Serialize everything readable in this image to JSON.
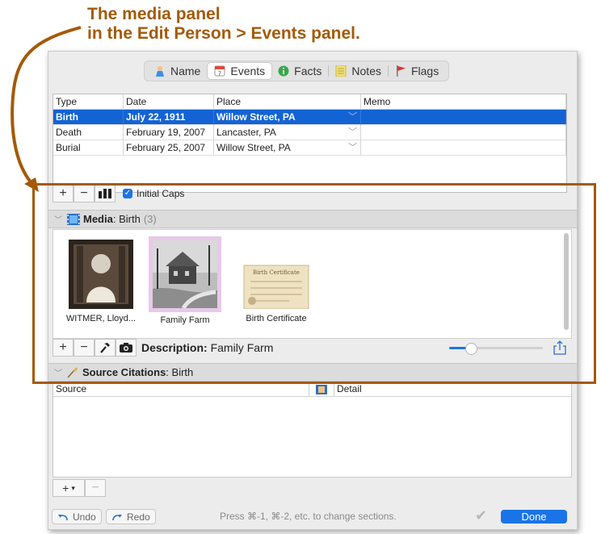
{
  "annotation": {
    "line1": "The media panel",
    "line2": "in the Edit Person > Events panel."
  },
  "tabs": [
    {
      "label": "Name",
      "icon": "person-icon"
    },
    {
      "label": "Events",
      "icon": "calendar-icon",
      "selected": true,
      "badge": "7"
    },
    {
      "label": "Facts",
      "icon": "info-icon"
    },
    {
      "label": "Notes",
      "icon": "notes-icon"
    },
    {
      "label": "Flags",
      "icon": "flag-icon"
    }
  ],
  "events": {
    "columns": [
      "Type",
      "Date",
      "Place",
      "Memo"
    ],
    "rows": [
      {
        "type": "Birth",
        "date": "July 22, 1911",
        "place": "Willow Street, PA",
        "memo": ""
      },
      {
        "type": "Death",
        "date": "February 19, 2007",
        "place": "Lancaster, PA",
        "memo": ""
      },
      {
        "type": "Burial",
        "date": "February 25, 2007",
        "place": "Willow Street, PA",
        "memo": ""
      }
    ],
    "selected_index": 0
  },
  "events_toolbar": {
    "add": "+",
    "remove": "−",
    "initial_caps_label": "Initial Caps",
    "initial_caps_checked": true
  },
  "media": {
    "header_bold": "Media",
    "header_rest": ": Birth",
    "count": "(3)",
    "items": [
      {
        "caption": "WITMER, Lloyd..."
      },
      {
        "caption": "Family Farm"
      },
      {
        "caption": "Birth Certificate"
      }
    ],
    "description_label": "Description:",
    "description_value": "Family Farm",
    "zoom_fraction": 0.22
  },
  "media_toolbar": {
    "add": "+",
    "remove": "−"
  },
  "sources": {
    "header_bold": "Source Citations",
    "header_rest": ": Birth",
    "col_source": "Source",
    "col_detail": "Detail"
  },
  "bottom": {
    "undo": "Undo",
    "redo": "Redo",
    "hint": "Press ⌘-1, ⌘-2, etc. to change sections.",
    "done": "Done"
  },
  "colors": {
    "selection": "#1463d4",
    "accent": "#1a74e8",
    "annotation": "#a45a08"
  }
}
